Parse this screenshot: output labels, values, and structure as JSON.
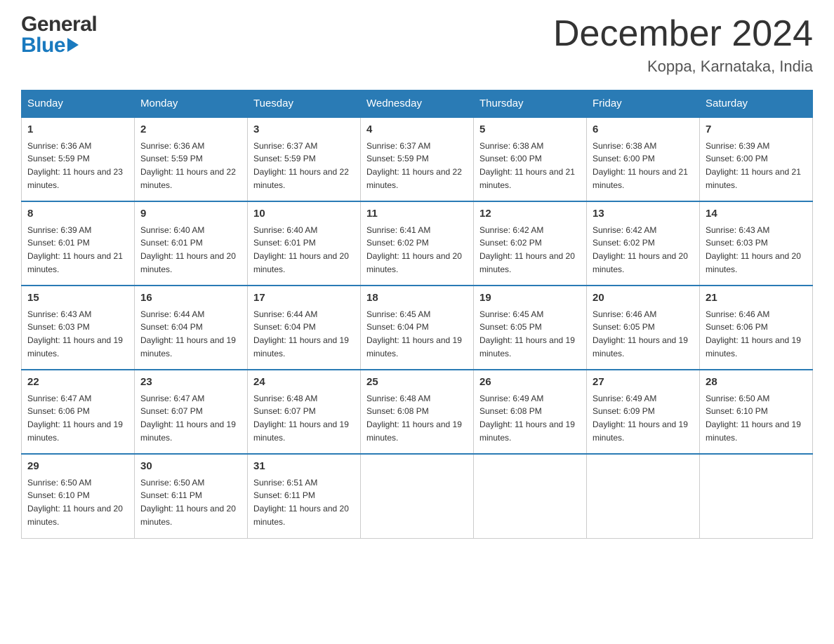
{
  "logo": {
    "line1": "General",
    "line2": "Blue"
  },
  "header": {
    "month": "December 2024",
    "location": "Koppa, Karnataka, India"
  },
  "weekdays": [
    "Sunday",
    "Monday",
    "Tuesday",
    "Wednesday",
    "Thursday",
    "Friday",
    "Saturday"
  ],
  "weeks": [
    [
      {
        "day": "1",
        "sunrise": "6:36 AM",
        "sunset": "5:59 PM",
        "daylight": "11 hours and 23 minutes."
      },
      {
        "day": "2",
        "sunrise": "6:36 AM",
        "sunset": "5:59 PM",
        "daylight": "11 hours and 22 minutes."
      },
      {
        "day": "3",
        "sunrise": "6:37 AM",
        "sunset": "5:59 PM",
        "daylight": "11 hours and 22 minutes."
      },
      {
        "day": "4",
        "sunrise": "6:37 AM",
        "sunset": "5:59 PM",
        "daylight": "11 hours and 22 minutes."
      },
      {
        "day": "5",
        "sunrise": "6:38 AM",
        "sunset": "6:00 PM",
        "daylight": "11 hours and 21 minutes."
      },
      {
        "day": "6",
        "sunrise": "6:38 AM",
        "sunset": "6:00 PM",
        "daylight": "11 hours and 21 minutes."
      },
      {
        "day": "7",
        "sunrise": "6:39 AM",
        "sunset": "6:00 PM",
        "daylight": "11 hours and 21 minutes."
      }
    ],
    [
      {
        "day": "8",
        "sunrise": "6:39 AM",
        "sunset": "6:01 PM",
        "daylight": "11 hours and 21 minutes."
      },
      {
        "day": "9",
        "sunrise": "6:40 AM",
        "sunset": "6:01 PM",
        "daylight": "11 hours and 20 minutes."
      },
      {
        "day": "10",
        "sunrise": "6:40 AM",
        "sunset": "6:01 PM",
        "daylight": "11 hours and 20 minutes."
      },
      {
        "day": "11",
        "sunrise": "6:41 AM",
        "sunset": "6:02 PM",
        "daylight": "11 hours and 20 minutes."
      },
      {
        "day": "12",
        "sunrise": "6:42 AM",
        "sunset": "6:02 PM",
        "daylight": "11 hours and 20 minutes."
      },
      {
        "day": "13",
        "sunrise": "6:42 AM",
        "sunset": "6:02 PM",
        "daylight": "11 hours and 20 minutes."
      },
      {
        "day": "14",
        "sunrise": "6:43 AM",
        "sunset": "6:03 PM",
        "daylight": "11 hours and 20 minutes."
      }
    ],
    [
      {
        "day": "15",
        "sunrise": "6:43 AM",
        "sunset": "6:03 PM",
        "daylight": "11 hours and 19 minutes."
      },
      {
        "day": "16",
        "sunrise": "6:44 AM",
        "sunset": "6:04 PM",
        "daylight": "11 hours and 19 minutes."
      },
      {
        "day": "17",
        "sunrise": "6:44 AM",
        "sunset": "6:04 PM",
        "daylight": "11 hours and 19 minutes."
      },
      {
        "day": "18",
        "sunrise": "6:45 AM",
        "sunset": "6:04 PM",
        "daylight": "11 hours and 19 minutes."
      },
      {
        "day": "19",
        "sunrise": "6:45 AM",
        "sunset": "6:05 PM",
        "daylight": "11 hours and 19 minutes."
      },
      {
        "day": "20",
        "sunrise": "6:46 AM",
        "sunset": "6:05 PM",
        "daylight": "11 hours and 19 minutes."
      },
      {
        "day": "21",
        "sunrise": "6:46 AM",
        "sunset": "6:06 PM",
        "daylight": "11 hours and 19 minutes."
      }
    ],
    [
      {
        "day": "22",
        "sunrise": "6:47 AM",
        "sunset": "6:06 PM",
        "daylight": "11 hours and 19 minutes."
      },
      {
        "day": "23",
        "sunrise": "6:47 AM",
        "sunset": "6:07 PM",
        "daylight": "11 hours and 19 minutes."
      },
      {
        "day": "24",
        "sunrise": "6:48 AM",
        "sunset": "6:07 PM",
        "daylight": "11 hours and 19 minutes."
      },
      {
        "day": "25",
        "sunrise": "6:48 AM",
        "sunset": "6:08 PM",
        "daylight": "11 hours and 19 minutes."
      },
      {
        "day": "26",
        "sunrise": "6:49 AM",
        "sunset": "6:08 PM",
        "daylight": "11 hours and 19 minutes."
      },
      {
        "day": "27",
        "sunrise": "6:49 AM",
        "sunset": "6:09 PM",
        "daylight": "11 hours and 19 minutes."
      },
      {
        "day": "28",
        "sunrise": "6:50 AM",
        "sunset": "6:10 PM",
        "daylight": "11 hours and 19 minutes."
      }
    ],
    [
      {
        "day": "29",
        "sunrise": "6:50 AM",
        "sunset": "6:10 PM",
        "daylight": "11 hours and 20 minutes."
      },
      {
        "day": "30",
        "sunrise": "6:50 AM",
        "sunset": "6:11 PM",
        "daylight": "11 hours and 20 minutes."
      },
      {
        "day": "31",
        "sunrise": "6:51 AM",
        "sunset": "6:11 PM",
        "daylight": "11 hours and 20 minutes."
      },
      null,
      null,
      null,
      null
    ]
  ]
}
